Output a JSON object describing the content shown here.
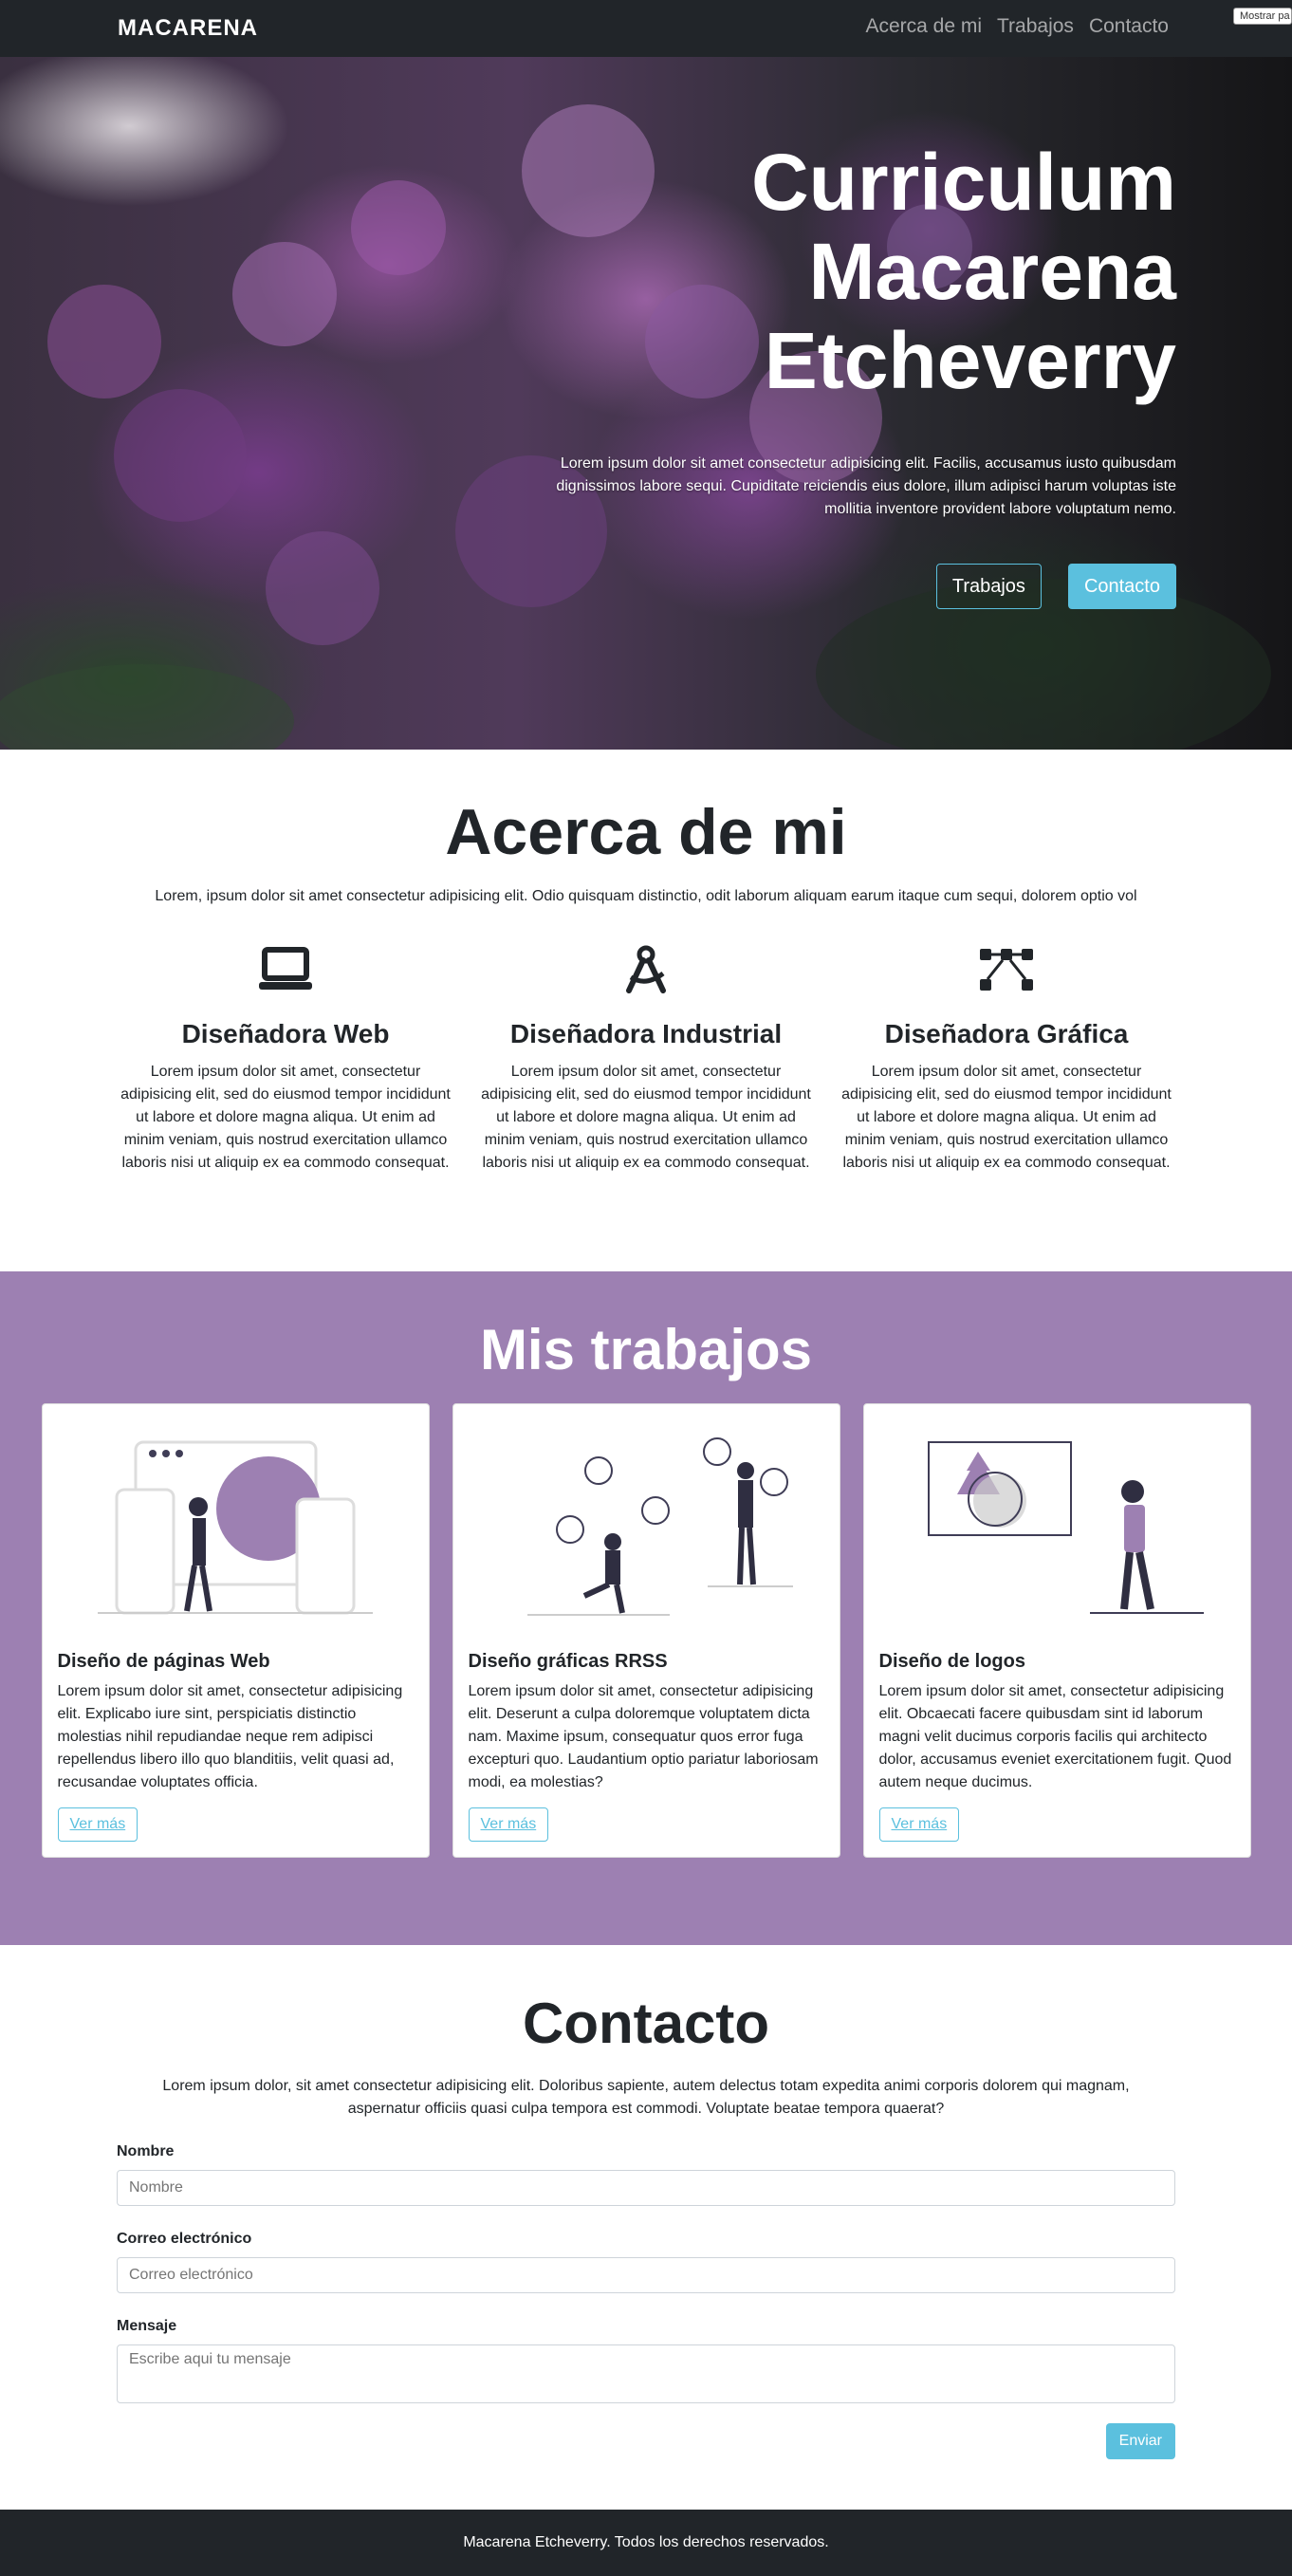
{
  "nav": {
    "brand": "MACARENA",
    "links": [
      "Acerca de mi",
      "Trabajos",
      "Contacto"
    ],
    "toggle": "Mostrar pa"
  },
  "hero": {
    "title": "Curriculum Macarena Etcheverry",
    "text": "Lorem ipsum dolor sit amet consectetur adipisicing elit. Facilis, accusamus iusto quibusdam dignissimos labore sequi. Cupiditate reiciendis eius dolore, illum adipisci harum voluptas iste mollitia inventore provident labore voluptatum nemo.",
    "btn_trabajos": "Trabajos",
    "btn_contacto": "Contacto"
  },
  "about": {
    "title": "Acerca de mi",
    "lead": "Lorem, ipsum dolor sit amet consectetur adipisicing elit. Odio quisquam distinctio, odit laborum aliquam earum itaque cum sequi, dolorem optio vol",
    "features": [
      {
        "icon": "laptop-icon",
        "title": "Diseñadora Web",
        "text": "Lorem ipsum dolor sit amet, consectetur adipisicing elit, sed do eiusmod tempor incididunt ut labore et dolore magna aliqua. Ut enim ad minim veniam, quis nostrud exercitation ullamco laboris nisi ut aliquip ex ea commodo consequat."
      },
      {
        "icon": "compass-drafting-icon",
        "title": "Diseñadora Industrial",
        "text": "Lorem ipsum dolor sit amet, consectetur adipisicing elit, sed do eiusmod tempor incididunt ut labore et dolore magna aliqua. Ut enim ad minim veniam, quis nostrud exercitation ullamco laboris nisi ut aliquip ex ea commodo consequat."
      },
      {
        "icon": "vector-nodes-icon",
        "title": "Diseñadora Gráfica",
        "text": "Lorem ipsum dolor sit amet, consectetur adipisicing elit, sed do eiusmod tempor incididunt ut labore et dolore magna aliqua. Ut enim ad minim veniam, quis nostrud exercitation ullamco laboris nisi ut aliquip ex ea commodo consequat."
      }
    ]
  },
  "works": {
    "title": "Mis trabajos",
    "cards": [
      {
        "title": "Diseño de páginas Web",
        "text": "Lorem ipsum dolor sit amet, consectetur adipisicing elit. Explicabo iure sint, perspiciatis distinctio molestias nihil repudiandae neque rem adipisci repellendus libero illo quo blanditiis, velit quasi ad, recusandae voluptates officia.",
        "button": "Ver más"
      },
      {
        "title": "Diseño gráficas RRSS",
        "text": "Lorem ipsum dolor sit amet, consectetur adipisicing elit. Deserunt a culpa doloremque voluptatem dicta nam. Maxime ipsum, consequatur quos error fuga excepturi quo. Laudantium optio pariatur laboriosam modi, ea molestias?",
        "button": "Ver más"
      },
      {
        "title": "Diseño de logos",
        "text": "Lorem ipsum dolor sit amet, consectetur adipisicing elit. Obcaecati facere quibusdam sint id laborum magni velit ducimus corporis facilis qui architecto dolor, accusamus eveniet exercitationem fugit. Quod autem neque ducimus.",
        "button": "Ver más"
      }
    ]
  },
  "contact": {
    "title": "Contacto",
    "lead": "Lorem ipsum dolor, sit amet consectetur adipisicing elit. Doloribus sapiente, autem delectus totam expedita animi corporis dolorem qui magnam, aspernatur officiis quasi culpa tempora est commodi. Voluptate beatae tempora quaerat?",
    "name_label": "Nombre",
    "name_placeholder": "Nombre",
    "email_label": "Correo electrónico",
    "email_placeholder": "Correo electrónico",
    "message_label": "Mensaje",
    "message_placeholder": "Escribe aqui tu mensaje",
    "submit": "Enviar"
  },
  "footer": {
    "text": "Macarena Etcheverry. Todos los derechos reservados."
  },
  "colors": {
    "navbar": "#212529",
    "accent": "#5bc0de",
    "purple": "#9d80b2"
  }
}
